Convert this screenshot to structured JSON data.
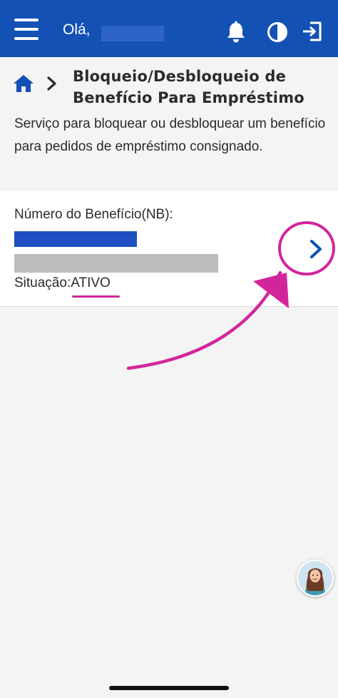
{
  "colors": {
    "header_bg": "#1351b4",
    "accent": "#1351b4",
    "annotation": "#d3259b",
    "page_bg": "#f4f4f4"
  },
  "header": {
    "menu_icon": "hamburger-menu-icon",
    "greeting": "Olá,",
    "user_name_redacted": true,
    "icons": [
      "bell-icon",
      "contrast-icon",
      "logout-icon"
    ]
  },
  "breadcrumb": {
    "home_icon": "home-icon",
    "separator_icon": "chevron-right-icon"
  },
  "page": {
    "title": "Bloqueio/Desbloqueio de Benefício Para Empréstimo",
    "description": "Serviço para bloquear ou desbloquear um benefício para pedidos de empréstimo consignado."
  },
  "benefit_card": {
    "number_label": "Número do Benefício(NB):",
    "number_redacted": true,
    "status_label": "Situação:",
    "status_value": "ATIVO",
    "action_icon": "chevron-right-icon"
  },
  "assistant": {
    "avatar_icon": "assistant-avatar-icon"
  }
}
